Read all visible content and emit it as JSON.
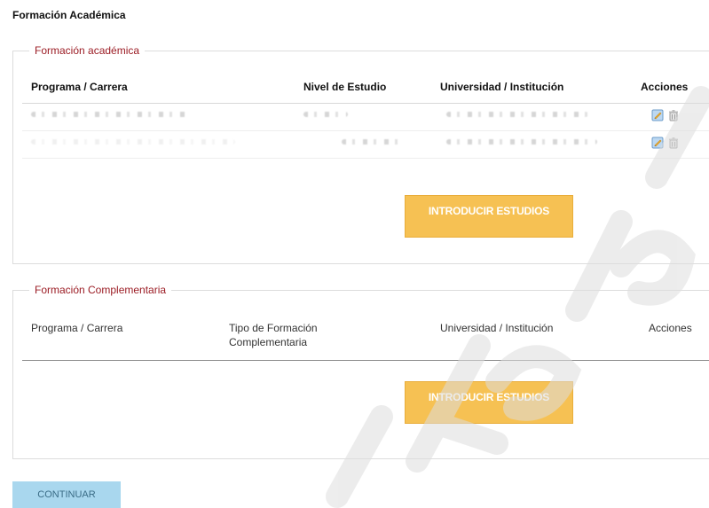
{
  "page_title": "Formación Académica",
  "section_academic": {
    "legend": "Formación académica",
    "columns": [
      "Programa / Carrera",
      "Nivel de Estudio",
      "Universidad / Institución",
      "Acciones"
    ],
    "add_button": "INTRODUCIR ESTUDIOS"
  },
  "section_complementary": {
    "legend": "Formación Complementaria",
    "columns": [
      "Programa / Carrera",
      "Tipo de Formación Complementaria",
      "Universidad / Institución",
      "Acciones"
    ],
    "add_button": "INTRODUCIR ESTUDIOS"
  },
  "continue_button": "CONTINUAR",
  "icons": {
    "edit": "edit-icon",
    "delete": "trash-icon"
  },
  "colors": {
    "legend": "#9b1c24",
    "add_button": "#f6c153",
    "continue_button": "#a9d7ee"
  }
}
